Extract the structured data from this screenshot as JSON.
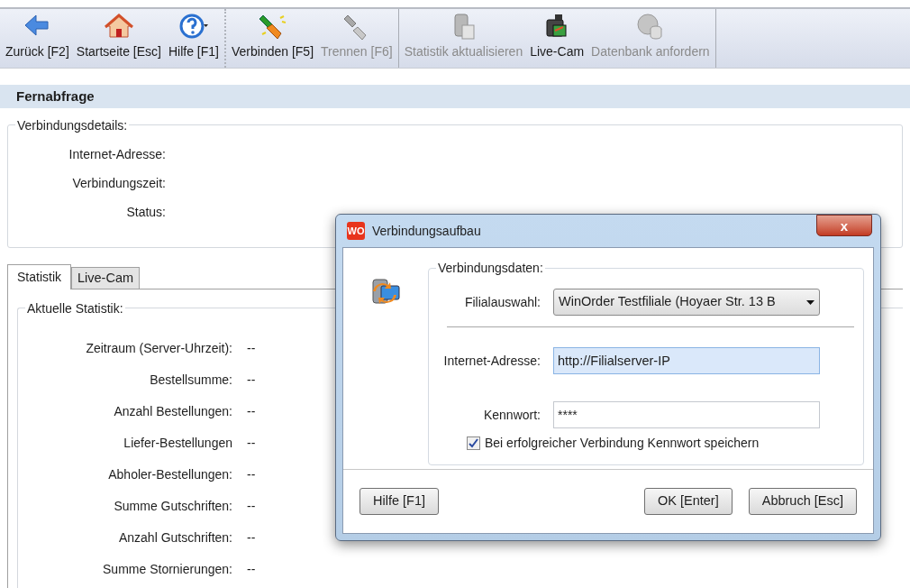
{
  "toolbar": {
    "groups": [
      {
        "items": [
          {
            "kind": "back",
            "label": "Zurück [F2]",
            "disabled": false
          },
          {
            "kind": "home",
            "label": "Startseite [Esc]",
            "disabled": false
          },
          {
            "kind": "help",
            "label": "Hilfe [F1]",
            "disabled": false
          }
        ]
      },
      {
        "items": [
          {
            "kind": "connect",
            "label": "Verbinden [F5]",
            "disabled": false
          },
          {
            "kind": "disconnect",
            "label": "Trennen [F6]",
            "disabled": true
          }
        ]
      },
      {
        "items": [
          {
            "kind": "refresh",
            "label": "Statistik aktualisieren",
            "disabled": true
          },
          {
            "kind": "camera",
            "label": "Live-Cam",
            "disabled": false
          },
          {
            "kind": "database",
            "label": "Datenbank anfordern",
            "disabled": true
          }
        ]
      }
    ]
  },
  "page_title": "Fernabfrage",
  "details": {
    "legend": "Verbindungsdetails:",
    "rows": [
      {
        "label": "Internet-Adresse:"
      },
      {
        "label": "Verbindungszeit:"
      },
      {
        "label": "Status:"
      }
    ]
  },
  "tabs": [
    {
      "label": "Statistik",
      "selected": true
    },
    {
      "label": "Live-Cam",
      "selected": false
    }
  ],
  "statistics": {
    "legend": "Aktuelle Statistik:",
    "rows": [
      {
        "label": "Zeitraum (Server-Uhrzeit):",
        "value": "--"
      },
      {
        "label": "Bestellsumme:",
        "value": "--"
      },
      {
        "label": "Anzahl Bestellungen:",
        "value": "--"
      },
      {
        "label": "Liefer-Bestellungen",
        "value": "--"
      },
      {
        "label": "Abholer-Bestellungen:",
        "value": "--"
      },
      {
        "label": "Summe Gutschriften:",
        "value": "--"
      },
      {
        "label": "Anzahl Gutschriften:",
        "value": "--"
      },
      {
        "label": "Summe Stornierungen:",
        "value": "--"
      }
    ]
  },
  "dialog": {
    "app_badge": "WO",
    "title": "Verbindungsaufbau",
    "close": "x",
    "legend": "Verbindungsdaten:",
    "branch": {
      "label": "Filialauswahl:",
      "value": "WinOrder Testfiliale (Hoyaer Str. 13 B"
    },
    "address": {
      "label": "Internet-Adresse:",
      "value": "http://Filialserver-IP",
      "focused": true
    },
    "password": {
      "label": "Kennwort:",
      "value": "****"
    },
    "save_password": {
      "label": "Bei erfolgreicher Verbindung Kennwort speichern",
      "checked": true
    },
    "buttons": [
      {
        "label": "Hilfe [F1]"
      },
      {
        "label": "OK [Enter]"
      },
      {
        "label": "Abbruch [Esc]"
      }
    ]
  }
}
